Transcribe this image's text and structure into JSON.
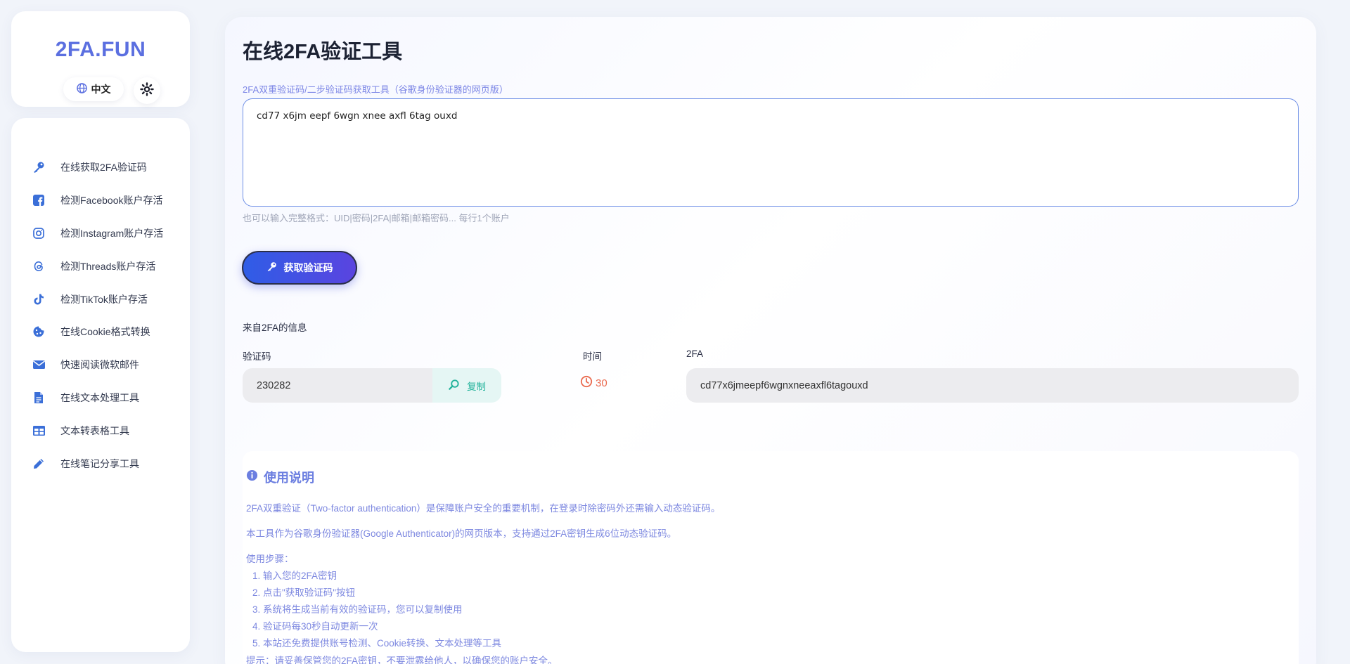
{
  "brand": {
    "title": "2FA.FUN",
    "lang_label": "中文"
  },
  "icons": {
    "globe": "globe-icon",
    "theme": "gear-sun-icon",
    "key": "key-icon",
    "facebook": "facebook-icon",
    "instagram": "instagram-icon",
    "threads": "threads-icon",
    "tiktok": "tiktok-icon",
    "cookie": "cookie-icon",
    "mail": "envelope-icon",
    "document": "document-icon",
    "table": "table-icon",
    "pencil": "pencil-icon",
    "search": "search-icon",
    "clock": "clock-icon",
    "info": "info-icon"
  },
  "colors": {
    "accent": "#5b6fe0",
    "button_start": "#2f5de6",
    "button_end": "#5a44e0",
    "copy": "#23b39b",
    "timer": "#ea6a4f",
    "info": "#7d88e0"
  },
  "sidebar": {
    "items": [
      {
        "label": "在线获取2FA验证码",
        "icon": "key-icon"
      },
      {
        "label": "检测Facebook账户存活",
        "icon": "facebook-icon"
      },
      {
        "label": "检测Instagram账户存活",
        "icon": "instagram-icon"
      },
      {
        "label": "检测Threads账户存活",
        "icon": "threads-icon"
      },
      {
        "label": "检测TikTok账户存活",
        "icon": "tiktok-icon"
      },
      {
        "label": "在线Cookie格式转换",
        "icon": "cookie-icon"
      },
      {
        "label": "快速阅读微软邮件",
        "icon": "envelope-icon"
      },
      {
        "label": "在线文本处理工具",
        "icon": "document-icon"
      },
      {
        "label": "文本转表格工具",
        "icon": "table-icon"
      },
      {
        "label": "在线笔记分享工具",
        "icon": "pencil-icon"
      }
    ]
  },
  "main": {
    "title": "在线2FA验证工具",
    "input_label": "2FA双重验证码/二步验证码获取工具（谷歌身份验证器的网页版）",
    "secret_value": "cd77 x6jm eepf 6wgn xnee axfl 6tag ouxd",
    "hint": "也可以输入完整格式：UID|密码|2FA|邮箱|邮箱密码... 每行1个账户",
    "get_button": "获取验证码",
    "result_section": "来自2FA的信息",
    "col_code": "验证码",
    "col_time": "时间",
    "col_2fa": "2FA",
    "code_value": "230282",
    "copy_label": "复制",
    "time_value": "30",
    "secret_clean": "cd77x6jmeepf6wgnxneeaxfl6tagouxd"
  },
  "instructions": {
    "title": "使用说明",
    "para1": "2FA双重验证（Two-factor authentication）是保障账户安全的重要机制，在登录时除密码外还需输入动态验证码。",
    "para2": "本工具作为谷歌身份验证器(Google Authenticator)的网页版本，支持通过2FA密钥生成6位动态验证码。",
    "steps_label": "使用步骤：",
    "steps": [
      "1. 输入您的2FA密钥",
      "2. 点击\"获取验证码\"按钮",
      "3. 系统将生成当前有效的验证码，您可以复制使用",
      "4. 验证码每30秒自动更新一次",
      "5. 本站还免费提供账号检测、Cookie转换、文本处理等工具"
    ],
    "tip": "提示：请妥善保管您的2FA密钥，不要泄露给他人，以确保您的账户安全。"
  }
}
